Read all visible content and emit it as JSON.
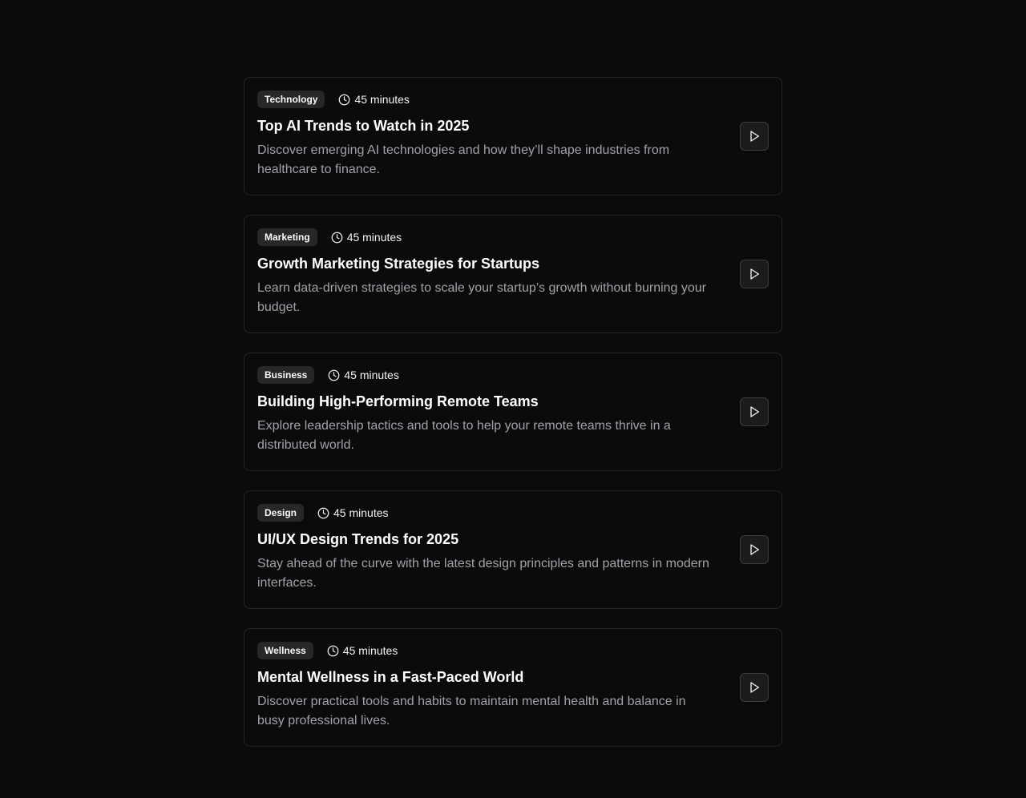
{
  "sessions": [
    {
      "category": "Technology",
      "duration": "45 minutes",
      "title": "Top AI Trends to Watch in 2025",
      "description": "Discover emerging AI technologies and how they’ll shape industries from healthcare to finance."
    },
    {
      "category": "Marketing",
      "duration": "45 minutes",
      "title": "Growth Marketing Strategies for Startups",
      "description": "Learn data-driven strategies to scale your startup’s growth without burning your budget."
    },
    {
      "category": "Business",
      "duration": "45 minutes",
      "title": "Building High-Performing Remote Teams",
      "description": "Explore leadership tactics and tools to help your remote teams thrive in a distributed world."
    },
    {
      "category": "Design",
      "duration": "45 minutes",
      "title": "UI/UX Design Trends for 2025",
      "description": "Stay ahead of the curve with the latest design principles and patterns in modern interfaces."
    },
    {
      "category": "Wellness",
      "duration": "45 minutes",
      "title": "Mental Wellness in a Fast-Paced World",
      "description": "Discover practical tools and habits to maintain mental health and balance in busy professional lives."
    }
  ],
  "icons": {
    "duration": "clock-icon",
    "action": "play-icon"
  },
  "colors": {
    "background": "#0b0b0c",
    "card_border": "#26262a",
    "badge_bg": "#27272a",
    "description_text": "#a1a1aa",
    "button_bg": "#1c1c1f"
  }
}
